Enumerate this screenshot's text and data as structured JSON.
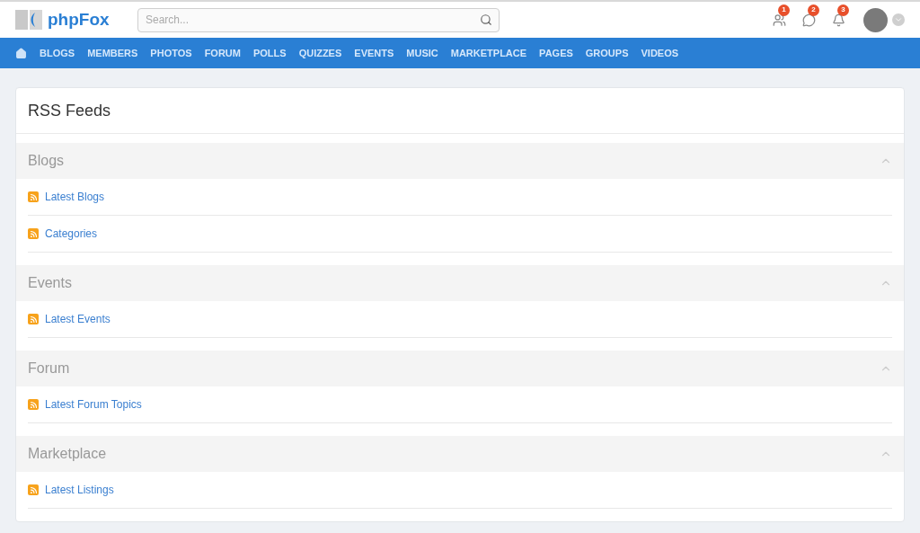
{
  "header": {
    "logo": "phpFox",
    "search": {
      "placeholder": "Search..."
    },
    "notifications": [
      {
        "kind": "friends",
        "count": "1"
      },
      {
        "kind": "messages",
        "count": "2"
      },
      {
        "kind": "alerts",
        "count": "3"
      }
    ]
  },
  "nav": {
    "items": [
      "BLOGS",
      "MEMBERS",
      "PHOTOS",
      "FORUM",
      "POLLS",
      "QUIZZES",
      "EVENTS",
      "MUSIC",
      "MARKETPLACE",
      "PAGES",
      "GROUPS",
      "VIDEOS"
    ]
  },
  "page": {
    "title": "RSS Feeds",
    "sections": [
      {
        "title": "Blogs",
        "expanded": true,
        "feeds": [
          "Latest Blogs",
          "Categories"
        ]
      },
      {
        "title": "Events",
        "expanded": true,
        "feeds": [
          "Latest Events"
        ]
      },
      {
        "title": "Forum",
        "expanded": true,
        "feeds": [
          "Latest Forum Topics"
        ]
      },
      {
        "title": "Marketplace",
        "expanded": true,
        "feeds": [
          "Latest Listings"
        ]
      }
    ]
  }
}
